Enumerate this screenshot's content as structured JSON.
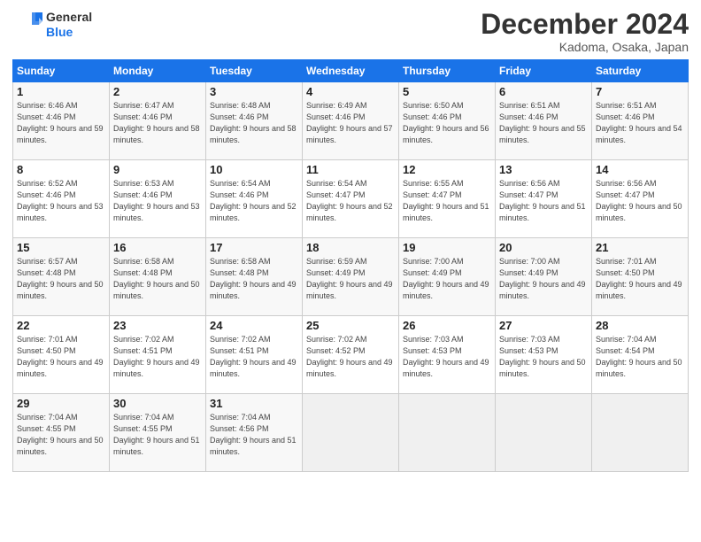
{
  "header": {
    "logo_line1": "General",
    "logo_line2": "Blue",
    "month": "December 2024",
    "location": "Kadoma, Osaka, Japan"
  },
  "weekdays": [
    "Sunday",
    "Monday",
    "Tuesday",
    "Wednesday",
    "Thursday",
    "Friday",
    "Saturday"
  ],
  "weeks": [
    [
      {
        "day": "1",
        "sunrise": "Sunrise: 6:46 AM",
        "sunset": "Sunset: 4:46 PM",
        "daylight": "Daylight: 9 hours and 59 minutes."
      },
      {
        "day": "2",
        "sunrise": "Sunrise: 6:47 AM",
        "sunset": "Sunset: 4:46 PM",
        "daylight": "Daylight: 9 hours and 58 minutes."
      },
      {
        "day": "3",
        "sunrise": "Sunrise: 6:48 AM",
        "sunset": "Sunset: 4:46 PM",
        "daylight": "Daylight: 9 hours and 58 minutes."
      },
      {
        "day": "4",
        "sunrise": "Sunrise: 6:49 AM",
        "sunset": "Sunset: 4:46 PM",
        "daylight": "Daylight: 9 hours and 57 minutes."
      },
      {
        "day": "5",
        "sunrise": "Sunrise: 6:50 AM",
        "sunset": "Sunset: 4:46 PM",
        "daylight": "Daylight: 9 hours and 56 minutes."
      },
      {
        "day": "6",
        "sunrise": "Sunrise: 6:51 AM",
        "sunset": "Sunset: 4:46 PM",
        "daylight": "Daylight: 9 hours and 55 minutes."
      },
      {
        "day": "7",
        "sunrise": "Sunrise: 6:51 AM",
        "sunset": "Sunset: 4:46 PM",
        "daylight": "Daylight: 9 hours and 54 minutes."
      }
    ],
    [
      {
        "day": "8",
        "sunrise": "Sunrise: 6:52 AM",
        "sunset": "Sunset: 4:46 PM",
        "daylight": "Daylight: 9 hours and 53 minutes."
      },
      {
        "day": "9",
        "sunrise": "Sunrise: 6:53 AM",
        "sunset": "Sunset: 4:46 PM",
        "daylight": "Daylight: 9 hours and 53 minutes."
      },
      {
        "day": "10",
        "sunrise": "Sunrise: 6:54 AM",
        "sunset": "Sunset: 4:46 PM",
        "daylight": "Daylight: 9 hours and 52 minutes."
      },
      {
        "day": "11",
        "sunrise": "Sunrise: 6:54 AM",
        "sunset": "Sunset: 4:47 PM",
        "daylight": "Daylight: 9 hours and 52 minutes."
      },
      {
        "day": "12",
        "sunrise": "Sunrise: 6:55 AM",
        "sunset": "Sunset: 4:47 PM",
        "daylight": "Daylight: 9 hours and 51 minutes."
      },
      {
        "day": "13",
        "sunrise": "Sunrise: 6:56 AM",
        "sunset": "Sunset: 4:47 PM",
        "daylight": "Daylight: 9 hours and 51 minutes."
      },
      {
        "day": "14",
        "sunrise": "Sunrise: 6:56 AM",
        "sunset": "Sunset: 4:47 PM",
        "daylight": "Daylight: 9 hours and 50 minutes."
      }
    ],
    [
      {
        "day": "15",
        "sunrise": "Sunrise: 6:57 AM",
        "sunset": "Sunset: 4:48 PM",
        "daylight": "Daylight: 9 hours and 50 minutes."
      },
      {
        "day": "16",
        "sunrise": "Sunrise: 6:58 AM",
        "sunset": "Sunset: 4:48 PM",
        "daylight": "Daylight: 9 hours and 50 minutes."
      },
      {
        "day": "17",
        "sunrise": "Sunrise: 6:58 AM",
        "sunset": "Sunset: 4:48 PM",
        "daylight": "Daylight: 9 hours and 49 minutes."
      },
      {
        "day": "18",
        "sunrise": "Sunrise: 6:59 AM",
        "sunset": "Sunset: 4:49 PM",
        "daylight": "Daylight: 9 hours and 49 minutes."
      },
      {
        "day": "19",
        "sunrise": "Sunrise: 7:00 AM",
        "sunset": "Sunset: 4:49 PM",
        "daylight": "Daylight: 9 hours and 49 minutes."
      },
      {
        "day": "20",
        "sunrise": "Sunrise: 7:00 AM",
        "sunset": "Sunset: 4:49 PM",
        "daylight": "Daylight: 9 hours and 49 minutes."
      },
      {
        "day": "21",
        "sunrise": "Sunrise: 7:01 AM",
        "sunset": "Sunset: 4:50 PM",
        "daylight": "Daylight: 9 hours and 49 minutes."
      }
    ],
    [
      {
        "day": "22",
        "sunrise": "Sunrise: 7:01 AM",
        "sunset": "Sunset: 4:50 PM",
        "daylight": "Daylight: 9 hours and 49 minutes."
      },
      {
        "day": "23",
        "sunrise": "Sunrise: 7:02 AM",
        "sunset": "Sunset: 4:51 PM",
        "daylight": "Daylight: 9 hours and 49 minutes."
      },
      {
        "day": "24",
        "sunrise": "Sunrise: 7:02 AM",
        "sunset": "Sunset: 4:51 PM",
        "daylight": "Daylight: 9 hours and 49 minutes."
      },
      {
        "day": "25",
        "sunrise": "Sunrise: 7:02 AM",
        "sunset": "Sunset: 4:52 PM",
        "daylight": "Daylight: 9 hours and 49 minutes."
      },
      {
        "day": "26",
        "sunrise": "Sunrise: 7:03 AM",
        "sunset": "Sunset: 4:53 PM",
        "daylight": "Daylight: 9 hours and 49 minutes."
      },
      {
        "day": "27",
        "sunrise": "Sunrise: 7:03 AM",
        "sunset": "Sunset: 4:53 PM",
        "daylight": "Daylight: 9 hours and 50 minutes."
      },
      {
        "day": "28",
        "sunrise": "Sunrise: 7:04 AM",
        "sunset": "Sunset: 4:54 PM",
        "daylight": "Daylight: 9 hours and 50 minutes."
      }
    ],
    [
      {
        "day": "29",
        "sunrise": "Sunrise: 7:04 AM",
        "sunset": "Sunset: 4:55 PM",
        "daylight": "Daylight: 9 hours and 50 minutes."
      },
      {
        "day": "30",
        "sunrise": "Sunrise: 7:04 AM",
        "sunset": "Sunset: 4:55 PM",
        "daylight": "Daylight: 9 hours and 51 minutes."
      },
      {
        "day": "31",
        "sunrise": "Sunrise: 7:04 AM",
        "sunset": "Sunset: 4:56 PM",
        "daylight": "Daylight: 9 hours and 51 minutes."
      },
      null,
      null,
      null,
      null
    ]
  ]
}
